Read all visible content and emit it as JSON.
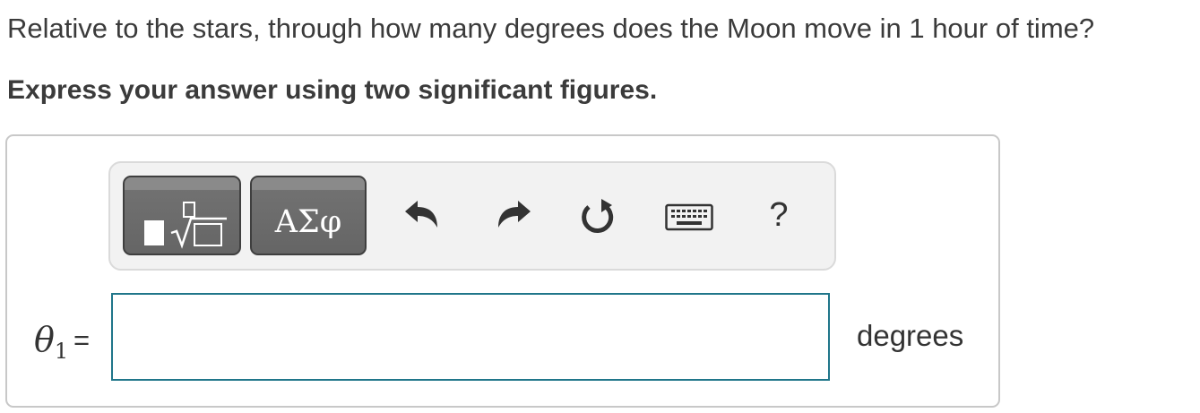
{
  "question": {
    "text": "Relative to the stars, through how many degrees does the Moon move in 1 hour of time?",
    "instruction": "Express your answer using two significant figures."
  },
  "toolbar": {
    "templates_icon": "fraction-sqrt-template-icon",
    "symbols_label": "ΑΣφ",
    "undo_icon": "undo-arrow-icon",
    "redo_icon": "redo-arrow-icon",
    "reset_icon": "reset-circular-arrow-icon",
    "keyboard_icon": "keyboard-icon",
    "help_label": "?"
  },
  "answer": {
    "variable_symbol": "θ",
    "variable_subscript": "1",
    "equals": "=",
    "value": "",
    "unit": "degrees"
  },
  "colors": {
    "input_border": "#20768a",
    "toolbar_button": "#6b6b6b",
    "panel_border": "#c8c8c8",
    "toolbar_bg": "#f2f2f2"
  }
}
